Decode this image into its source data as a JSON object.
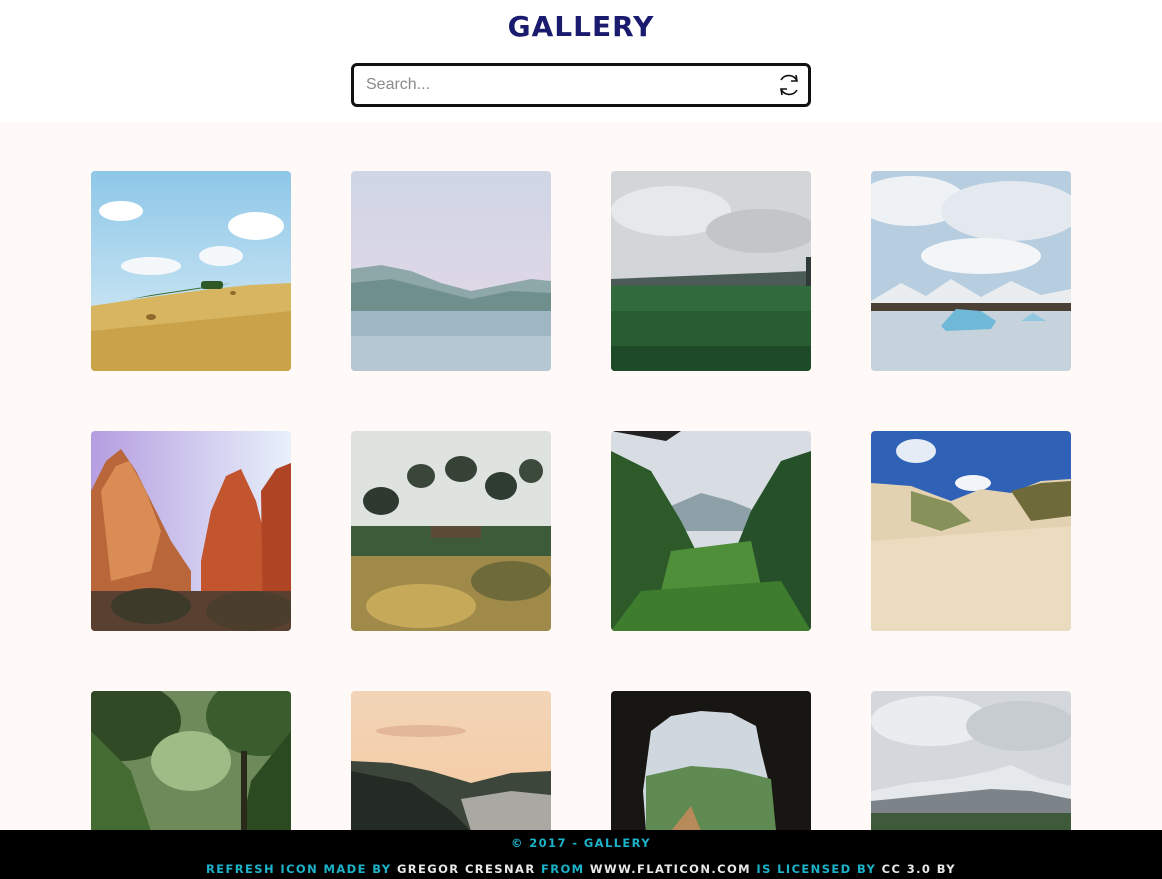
{
  "header": {
    "title": "GALLERY",
    "search": {
      "placeholder": "Search...",
      "value": ""
    },
    "refresh_icon": "refresh-icon"
  },
  "gallery": {
    "images": [
      {
        "name": "golden-field-hay-bales",
        "scene": "field"
      },
      {
        "name": "misty-lake-mountains",
        "scene": "lake"
      },
      {
        "name": "green-meadow-cloudy",
        "scene": "meadow"
      },
      {
        "name": "glacier-lagoon-icebergs",
        "scene": "glacier"
      },
      {
        "name": "red-rock-canyon",
        "scene": "canyon"
      },
      {
        "name": "overgrown-garden",
        "scene": "garden"
      },
      {
        "name": "jungle-valley",
        "scene": "jungle"
      },
      {
        "name": "sand-dunes-grass",
        "scene": "dunes"
      },
      {
        "name": "forest-path",
        "scene": "forest"
      },
      {
        "name": "coastal-sunset",
        "scene": "coast"
      },
      {
        "name": "cave-view-valley",
        "scene": "cave"
      },
      {
        "name": "snowy-mountain-plain",
        "scene": "mountain"
      }
    ]
  },
  "footer": {
    "copyright": "© 2017 - GALLERY",
    "credit": {
      "prefix": "REFRESH ICON MADE BY",
      "author": "GREGOR CRESNAR",
      "from": "FROM",
      "site": "WWW.FLATICON.COM",
      "licensed": "IS LICENSED BY",
      "license": "CC 3.0 BY"
    }
  }
}
